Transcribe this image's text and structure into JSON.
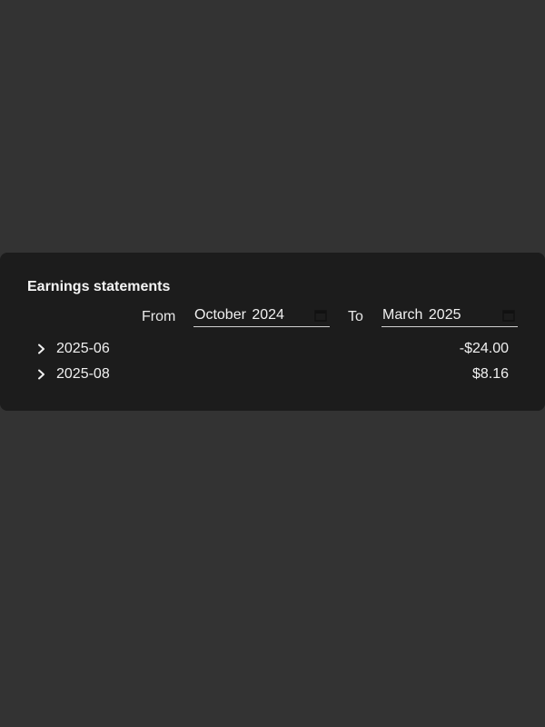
{
  "page": {
    "background": "#333333",
    "card_background": "#1c1c1c"
  },
  "statements": {
    "title": "Earnings statements",
    "range": {
      "from_label": "From",
      "from_value": "October 2024",
      "to_label": "To",
      "to_value": "March 2025",
      "picker_icon": "calendar-icon"
    },
    "rows": [
      {
        "period": "2025-06",
        "amount": "-$24.00",
        "icon": "chevron-right-icon"
      },
      {
        "period": "2025-08",
        "amount": "$8.16",
        "icon": "chevron-right-icon"
      }
    ]
  }
}
